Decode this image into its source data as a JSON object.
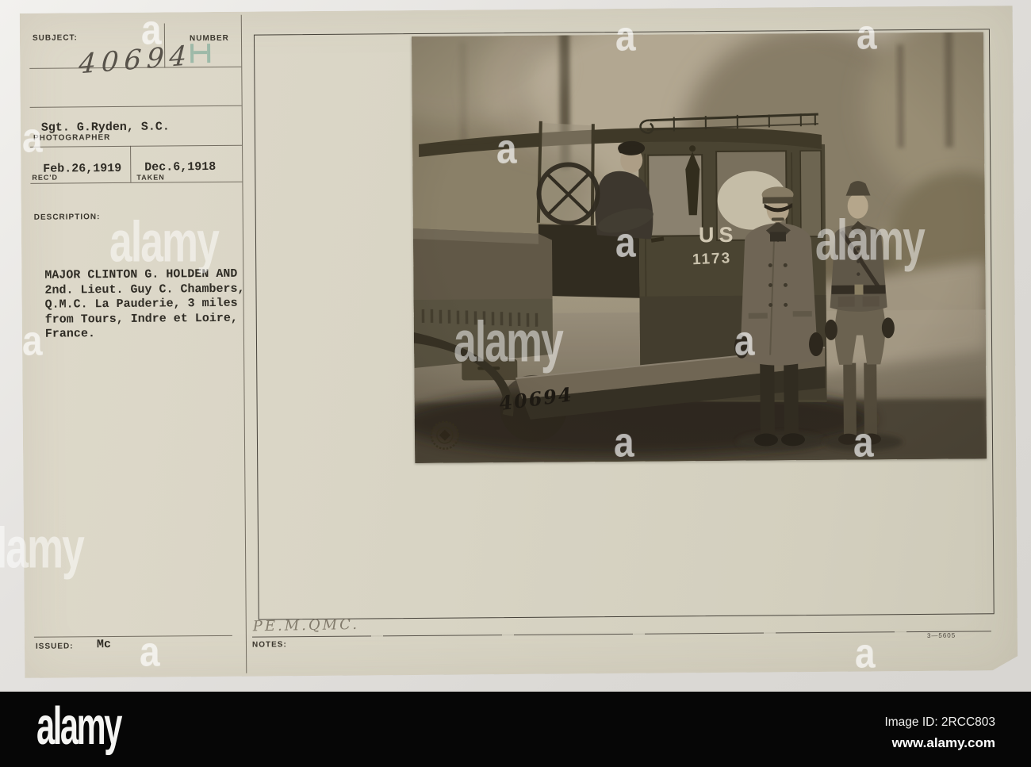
{
  "card": {
    "labels": {
      "subject": "SUBJECT:",
      "number": "NUMBER",
      "photographer": "PHOTOGRAPHER",
      "recd": "REC'D",
      "taken": "TAKEN",
      "description": "DESCRIPTION:",
      "issued": "ISSUED:",
      "notes": "NOTES:"
    },
    "subject_number": "40694",
    "photographer_name": "Sgt. G.Ryden, S.C.",
    "date_received": "Feb.26,1919",
    "date_taken": "Dec.6,1918",
    "description_lines": [
      "MAJOR CLINTON G. HOLDEN AND",
      "2nd. Lieut. Guy C. Chambers,",
      "Q.M.C. La Pauderie, 3 miles",
      "from Tours, Indre et Loire,",
      "France."
    ],
    "issued_value": "Mc",
    "notes_handwritten": "PE.M.QMC.",
    "form_number": "3—5605"
  },
  "photo": {
    "stencil_us": "US",
    "stencil_number": "1173",
    "inked_number": "40694"
  },
  "footer": {
    "logo": "alamy",
    "image_id": "Image ID: 2RCC803",
    "url": "www.alamy.com"
  },
  "watermark": {
    "letter": "a",
    "word": "alamy"
  },
  "colors": {
    "card_cream": "#d8d4c4",
    "bar_black": "#060606",
    "stamp_teal": "#74a795",
    "photo_sepia": "#a89e8c",
    "ink": "#2f2c25"
  }
}
